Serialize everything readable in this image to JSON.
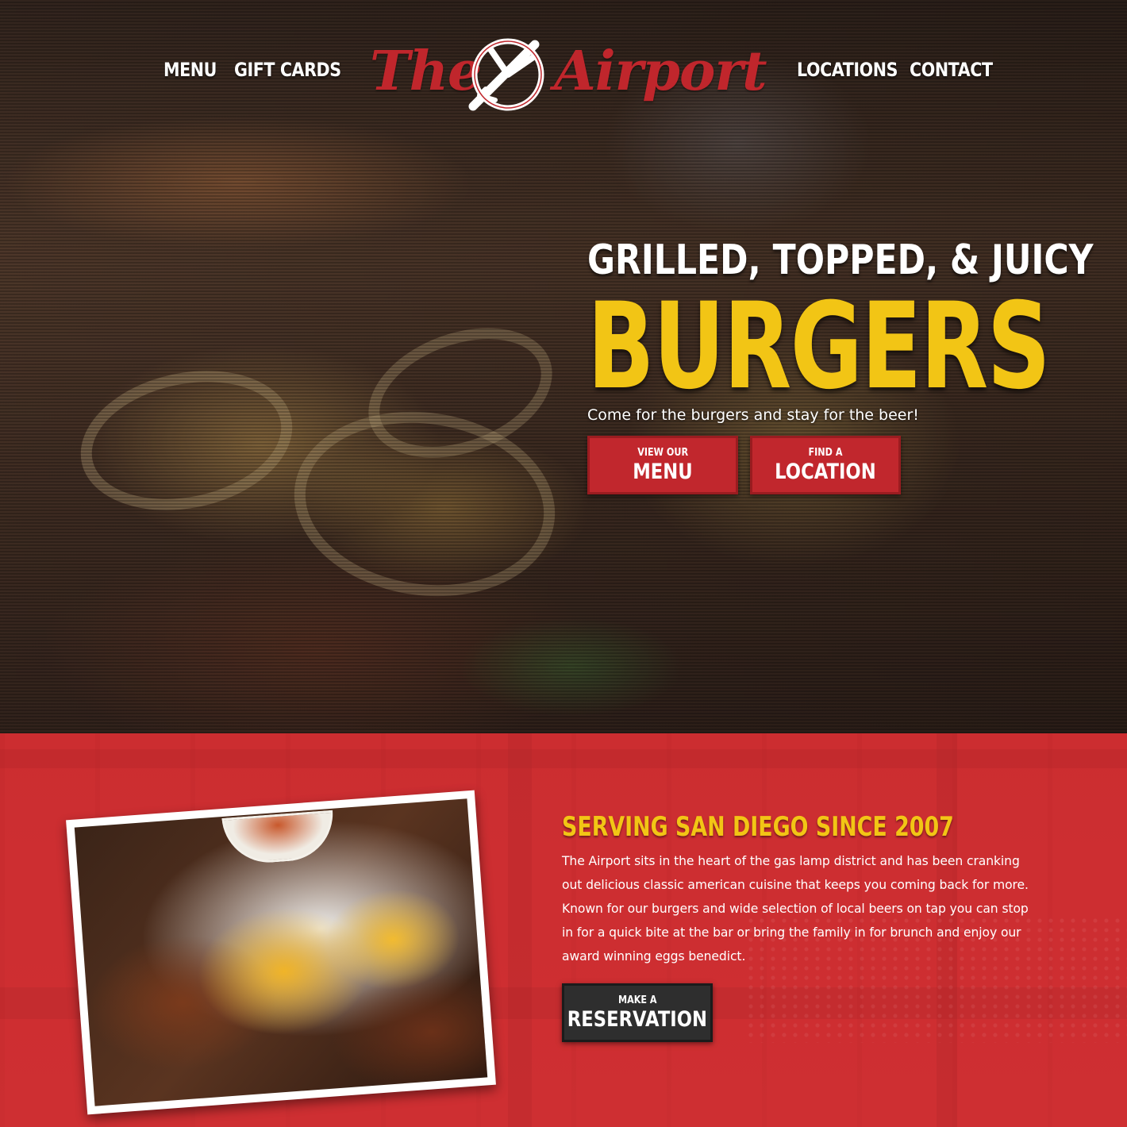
{
  "nav": {
    "left": [
      "MENU",
      "GIFT CARDS"
    ],
    "right": [
      "LOCATIONS",
      "CONTACT"
    ],
    "logo": {
      "word1": "The",
      "word2": "Airport",
      "icon": "airplane-icon"
    }
  },
  "hero": {
    "tagline": "GRILLED, TOPPED, & JUICY",
    "headline": "BURGERS",
    "subtext": "Come for the burgers and stay for the beer!",
    "buttons": [
      {
        "small": "VIEW OUR",
        "big": "MENU"
      },
      {
        "small": "FIND A",
        "big": "LOCATION"
      }
    ]
  },
  "about": {
    "title": "SERVING SAN DIEGO SINCE 2007",
    "body": "The Airport sits in the heart of the gas lamp district and has been cranking out delicious classic american cuisine that keeps you coming back for more. Known for our burgers and wide selection of local beers on tap you can stop in for a quick bite at the bar or bring the family in for brunch and enjoy our award winning eggs benedict.",
    "button": {
      "small": "MAKE A",
      "big": "RESERVATION"
    }
  },
  "colors": {
    "brand_red": "#c1272d",
    "accent_yellow": "#f2c515",
    "button_dark": "#2e2e2e"
  }
}
